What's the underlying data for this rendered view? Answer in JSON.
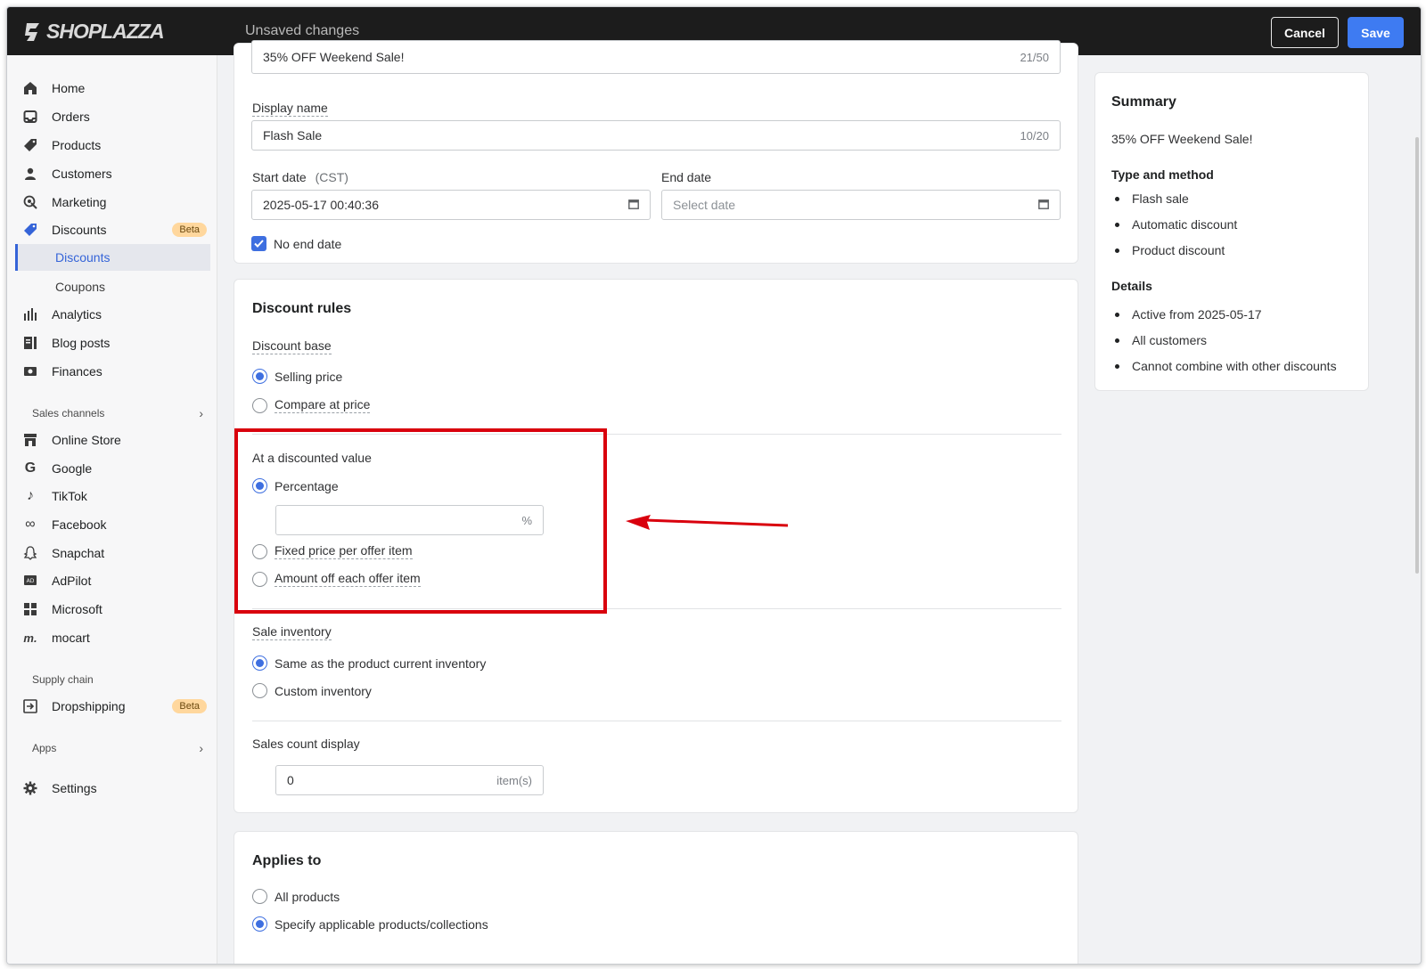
{
  "app": {
    "logo_text": "SHOPLAZZA",
    "status": "Unsaved changes",
    "cancel_label": "Cancel",
    "save_label": "Save"
  },
  "sidebar": {
    "items": [
      {
        "label": "Home",
        "icon": "home-icon"
      },
      {
        "label": "Orders",
        "icon": "inbox-icon"
      },
      {
        "label": "Products",
        "icon": "tag-icon"
      },
      {
        "label": "Customers",
        "icon": "person-icon"
      },
      {
        "label": "Marketing",
        "icon": "target-icon"
      },
      {
        "label": "Discounts",
        "icon": "discount-tag-icon",
        "badge": "Beta"
      }
    ],
    "discount_sub": [
      "Discounts",
      "Coupons"
    ],
    "items2": [
      {
        "label": "Analytics",
        "icon": "bar-chart-icon"
      },
      {
        "label": "Blog posts",
        "icon": "blog-icon"
      },
      {
        "label": "Finances",
        "icon": "finances-icon"
      }
    ],
    "sales_channels_label": "Sales channels",
    "channels": [
      {
        "label": "Online Store",
        "icon": "store-icon"
      },
      {
        "label": "Google",
        "icon": "google-icon"
      },
      {
        "label": "TikTok",
        "icon": "tiktok-icon"
      },
      {
        "label": "Facebook",
        "icon": "meta-icon"
      },
      {
        "label": "Snapchat",
        "icon": "snapchat-icon"
      },
      {
        "label": "AdPilot",
        "icon": "adpilot-icon"
      },
      {
        "label": "Microsoft",
        "icon": "microsoft-icon"
      },
      {
        "label": "mocart",
        "icon": "mocart-icon"
      }
    ],
    "supply_chain_label": "Supply chain",
    "dropshipping": {
      "label": "Dropshipping",
      "badge": "Beta"
    },
    "apps_label": "Apps",
    "settings_label": "Settings"
  },
  "basic": {
    "title_value": "35% OFF Weekend Sale!",
    "title_count": "21/50",
    "display_name_label": "Display name",
    "display_name_value": "Flash Sale",
    "display_name_count": "10/20",
    "start_date_label": "Start date",
    "start_date_tz": "(CST)",
    "start_date_value": "2025-05-17 00:40:36",
    "end_date_label": "End date",
    "end_date_placeholder": "Select date",
    "no_end_date_label": "No end date",
    "no_end_date_checked": true
  },
  "rules": {
    "heading": "Discount rules",
    "base_label": "Discount base",
    "base_options": [
      "Selling price",
      "Compare at price"
    ],
    "base_selected": 0,
    "value_label": "At a discounted value",
    "value_options": [
      "Percentage",
      "Fixed price per offer item",
      "Amount off each offer item"
    ],
    "value_selected": 0,
    "percentage_value": "",
    "percentage_suffix": "%",
    "inventory_label": "Sale inventory",
    "inventory_options": [
      "Same as the product current inventory",
      "Custom inventory"
    ],
    "inventory_selected": 0,
    "sales_count_label": "Sales count display",
    "sales_count_value": "0",
    "sales_count_suffix": "item(s)"
  },
  "applies": {
    "heading": "Applies to",
    "options": [
      "All products",
      "Specify applicable products/collections"
    ],
    "selected": 1
  },
  "summary": {
    "title": "Summary",
    "name": "35% OFF Weekend Sale!",
    "type_heading": "Type and method",
    "type_items": [
      "Flash sale",
      "Automatic discount",
      "Product discount"
    ],
    "details_heading": "Details",
    "details_items": [
      "Active from 2025-05-17",
      "All customers",
      "Cannot combine with other discounts"
    ]
  },
  "colors": {
    "accent": "#3e6fe0",
    "save_button": "#3e7bf2",
    "highlight": "#d9000d",
    "topbar": "#1c1c1c",
    "beta_badge": "#ffd79d"
  }
}
